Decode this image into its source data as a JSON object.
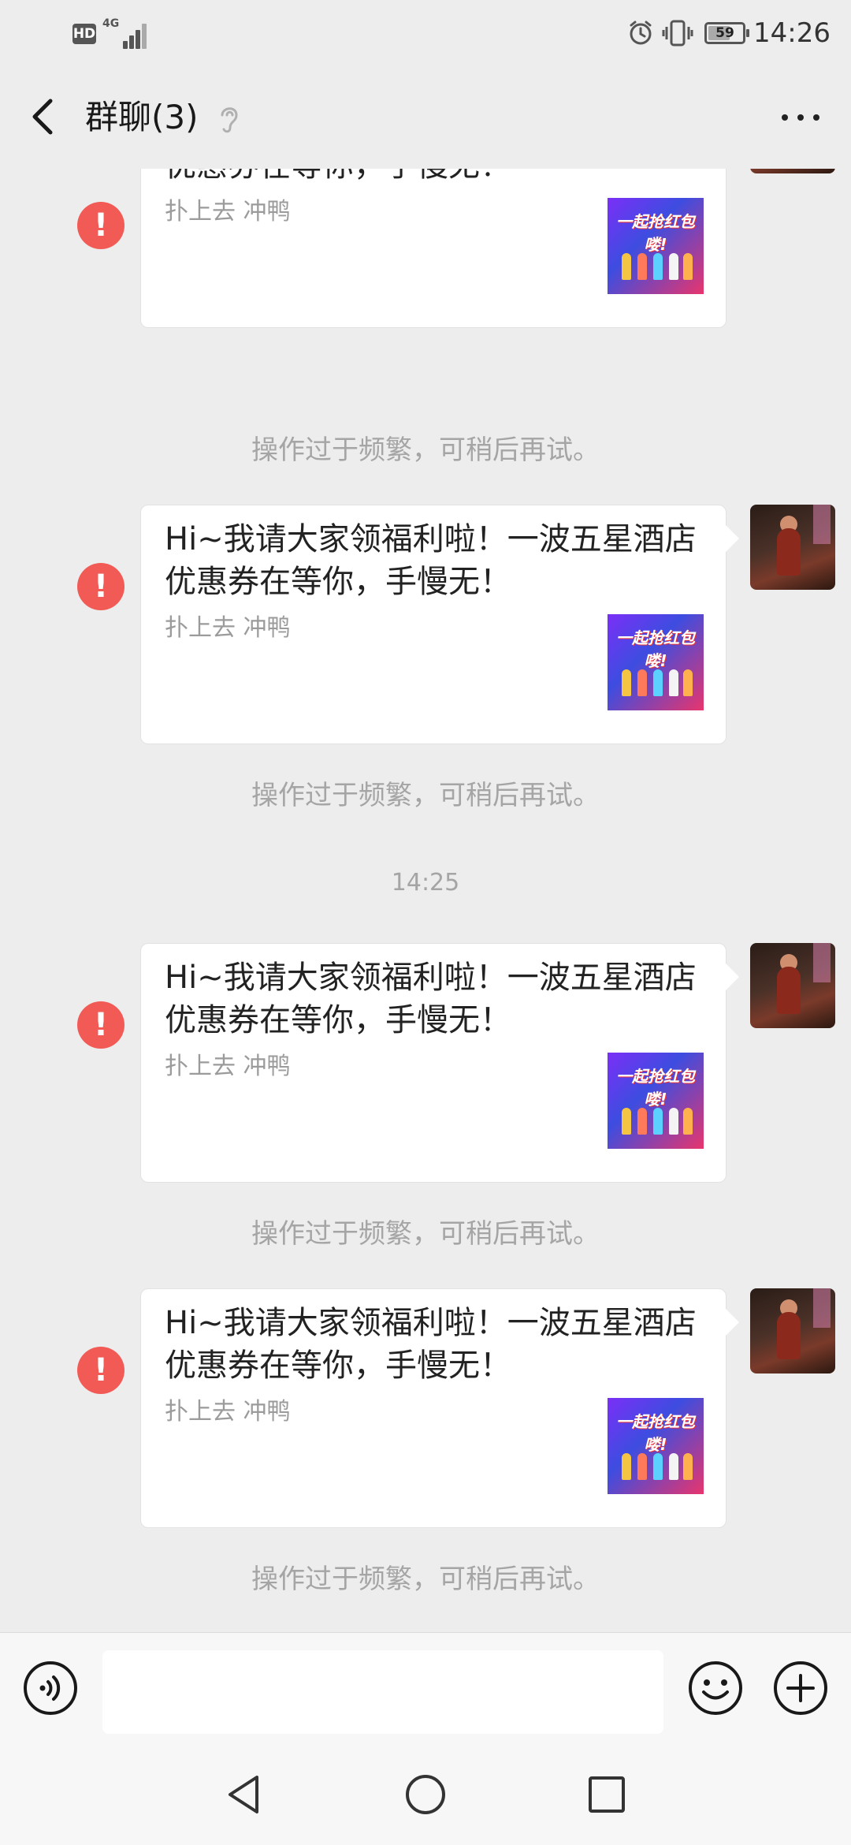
{
  "status_bar": {
    "hd": "HD",
    "network": "4G",
    "battery": "59",
    "time": "14:26"
  },
  "header": {
    "title": "群聊(3)"
  },
  "messages": [
    {
      "title": "Hi~我请大家领福利啦！一波五星酒店优惠券在等你，手慢无！",
      "desc": "扑上去 冲鸭",
      "thumb_text": "一起抢红包喽!",
      "fail_mark": "!",
      "system_notice": "操作过于频繁，可稍后再试。"
    },
    {
      "title": "Hi~我请大家领福利啦！一波五星酒店优惠券在等你，手慢无！",
      "desc": "扑上去 冲鸭",
      "thumb_text": "一起抢红包喽!",
      "fail_mark": "!",
      "system_notice": "操作过于频繁，可稍后再试。"
    },
    {
      "title": "Hi~我请大家领福利啦！一波五星酒店优惠券在等你，手慢无！",
      "desc": "扑上去 冲鸭",
      "thumb_text": "一起抢红包喽!",
      "fail_mark": "!",
      "system_notice": "操作过于频繁，可稍后再试。"
    },
    {
      "title": "Hi~我请大家领福利啦！一波五星酒店优惠券在等你，手慢无！",
      "desc": "扑上去 冲鸭",
      "thumb_text": "一起抢红包喽!",
      "fail_mark": "!",
      "system_notice": "操作过于频繁，可稍后再试。"
    }
  ],
  "time_separator": "14:25",
  "input": {
    "value": "",
    "placeholder": ""
  },
  "icons": {
    "back": "chevron-left-icon",
    "ear": "ear-icon",
    "more": "more-dots-icon",
    "fail": "exclamation-circle-icon",
    "voice": "voice-icon",
    "emoji": "emoji-icon",
    "plus": "plus-circle-icon",
    "nav_back": "triangle-back-icon",
    "nav_home": "circle-home-icon",
    "nav_recent": "square-recent-icon"
  },
  "colors": {
    "background": "#ededed",
    "card": "#ffffff",
    "fail_badge": "#f25a55",
    "muted_text": "#a5a5a5"
  }
}
